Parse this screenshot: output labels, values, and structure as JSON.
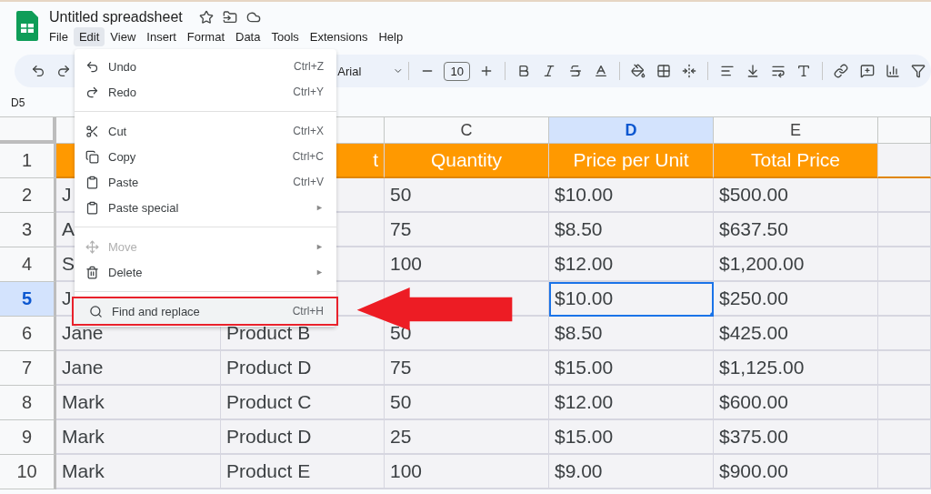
{
  "document": {
    "title": "Untitled spreadsheet"
  },
  "menu_bar": [
    {
      "label": "File",
      "selected": false
    },
    {
      "label": "Edit",
      "selected": true
    },
    {
      "label": "View",
      "selected": false
    },
    {
      "label": "Insert",
      "selected": false
    },
    {
      "label": "Format",
      "selected": false
    },
    {
      "label": "Data",
      "selected": false
    },
    {
      "label": "Tools",
      "selected": false
    },
    {
      "label": "Extensions",
      "selected": false
    },
    {
      "label": "Help",
      "selected": false
    }
  ],
  "toolbar": {
    "font": "Arial",
    "font_size": "10"
  },
  "name_box": "D5",
  "columns": [
    {
      "selected": false
    },
    {
      "selected": false
    },
    {
      "label": "C",
      "selected": false
    },
    {
      "label": "D",
      "selected": true
    },
    {
      "label": "E",
      "selected": false
    },
    {
      "selected": false
    }
  ],
  "rows": [
    {
      "number": "1",
      "selected": false,
      "kind": "header",
      "cells": [
        {
          "selected": false
        },
        {
          "text": "t",
          "cut": true,
          "selected": false
        },
        {
          "text": "Quantity",
          "selected": false
        },
        {
          "text": "Price per Unit",
          "selected": false
        },
        {
          "text": "Total Price",
          "selected": false
        },
        {
          "selected": false
        }
      ]
    },
    {
      "number": "2",
      "selected": false,
      "kind": "data",
      "cells": [
        {
          "text": "J",
          "selected": false
        },
        {
          "selected": false
        },
        {
          "text": "50",
          "selected": false
        },
        {
          "text": "$10.00",
          "selected": false
        },
        {
          "text": "$500.00",
          "selected": false
        },
        {
          "selected": false
        }
      ]
    },
    {
      "number": "3",
      "selected": false,
      "kind": "data",
      "cells": [
        {
          "text": "A",
          "selected": false
        },
        {
          "selected": false
        },
        {
          "text": "75",
          "selected": false
        },
        {
          "text": "$8.50",
          "selected": false
        },
        {
          "text": "$637.50",
          "selected": false
        },
        {
          "selected": false
        }
      ]
    },
    {
      "number": "4",
      "selected": false,
      "kind": "data",
      "cells": [
        {
          "text": "S",
          "selected": false
        },
        {
          "selected": false
        },
        {
          "text": "100",
          "selected": false
        },
        {
          "text": "$12.00",
          "selected": false
        },
        {
          "text": "$1,200.00",
          "selected": false
        },
        {
          "selected": false
        }
      ]
    },
    {
      "number": "5",
      "selected": true,
      "kind": "data",
      "cells": [
        {
          "text": "J",
          "selected": false
        },
        {
          "selected": false
        },
        {
          "selected": false
        },
        {
          "text": "$10.00",
          "selected": true
        },
        {
          "text": "$250.00",
          "selected": false
        },
        {
          "selected": false
        }
      ]
    },
    {
      "number": "6",
      "selected": false,
      "kind": "data",
      "cells": [
        {
          "text": "Jane",
          "selected": false
        },
        {
          "text": "Product B",
          "selected": false
        },
        {
          "text": "50",
          "selected": false
        },
        {
          "text": "$8.50",
          "selected": false
        },
        {
          "text": "$425.00",
          "selected": false
        },
        {
          "selected": false
        }
      ]
    },
    {
      "number": "7",
      "selected": false,
      "kind": "data",
      "cells": [
        {
          "text": "Jane",
          "selected": false
        },
        {
          "text": "Product D",
          "selected": false
        },
        {
          "text": "75",
          "selected": false
        },
        {
          "text": "$15.00",
          "selected": false
        },
        {
          "text": "$1,125.00",
          "selected": false
        },
        {
          "selected": false
        }
      ]
    },
    {
      "number": "8",
      "selected": false,
      "kind": "data",
      "cells": [
        {
          "text": "Mark",
          "selected": false
        },
        {
          "text": "Product C",
          "selected": false
        },
        {
          "text": "50",
          "selected": false
        },
        {
          "text": "$12.00",
          "selected": false
        },
        {
          "text": "$600.00",
          "selected": false
        },
        {
          "selected": false
        }
      ]
    },
    {
      "number": "9",
      "selected": false,
      "kind": "data",
      "cells": [
        {
          "text": "Mark",
          "selected": false
        },
        {
          "text": "Product D",
          "selected": false
        },
        {
          "text": "25",
          "selected": false
        },
        {
          "text": "$15.00",
          "selected": false
        },
        {
          "text": "$375.00",
          "selected": false
        },
        {
          "selected": false
        }
      ]
    },
    {
      "number": "10",
      "selected": false,
      "kind": "data",
      "cells": [
        {
          "text": "Mark",
          "selected": false
        },
        {
          "text": "Product E",
          "selected": false
        },
        {
          "text": "100",
          "selected": false
        },
        {
          "text": "$9.00",
          "selected": false
        },
        {
          "text": "$900.00",
          "selected": false
        },
        {
          "selected": false
        }
      ]
    }
  ],
  "edit_menu": [
    {
      "kind": "undo",
      "label": "Undo",
      "shortcut": "Ctrl+Z",
      "disabled": false,
      "selected": false
    },
    {
      "kind": "redo",
      "label": "Redo",
      "shortcut": "Ctrl+Y",
      "disabled": false,
      "selected": false
    },
    {
      "kind": "divider"
    },
    {
      "kind": "cut",
      "label": "Cut",
      "shortcut": "Ctrl+X",
      "disabled": false,
      "selected": false
    },
    {
      "kind": "copy",
      "label": "Copy",
      "shortcut": "Ctrl+C",
      "disabled": false,
      "selected": false
    },
    {
      "kind": "paste",
      "label": "Paste",
      "shortcut": "Ctrl+V",
      "disabled": false,
      "selected": false
    },
    {
      "kind": "paste",
      "label": "Paste special",
      "submenu": "►",
      "disabled": false,
      "selected": false
    },
    {
      "kind": "divider"
    },
    {
      "kind": "move",
      "label": "Move",
      "submenu": "►",
      "disabled": true,
      "selected": false
    },
    {
      "kind": "delete",
      "label": "Delete",
      "submenu": "►",
      "disabled": false,
      "selected": false
    },
    {
      "kind": "divider"
    },
    {
      "kind": "find",
      "label": "Find and replace",
      "shortcut": "Ctrl+H",
      "disabled": false,
      "selected": true
    }
  ]
}
